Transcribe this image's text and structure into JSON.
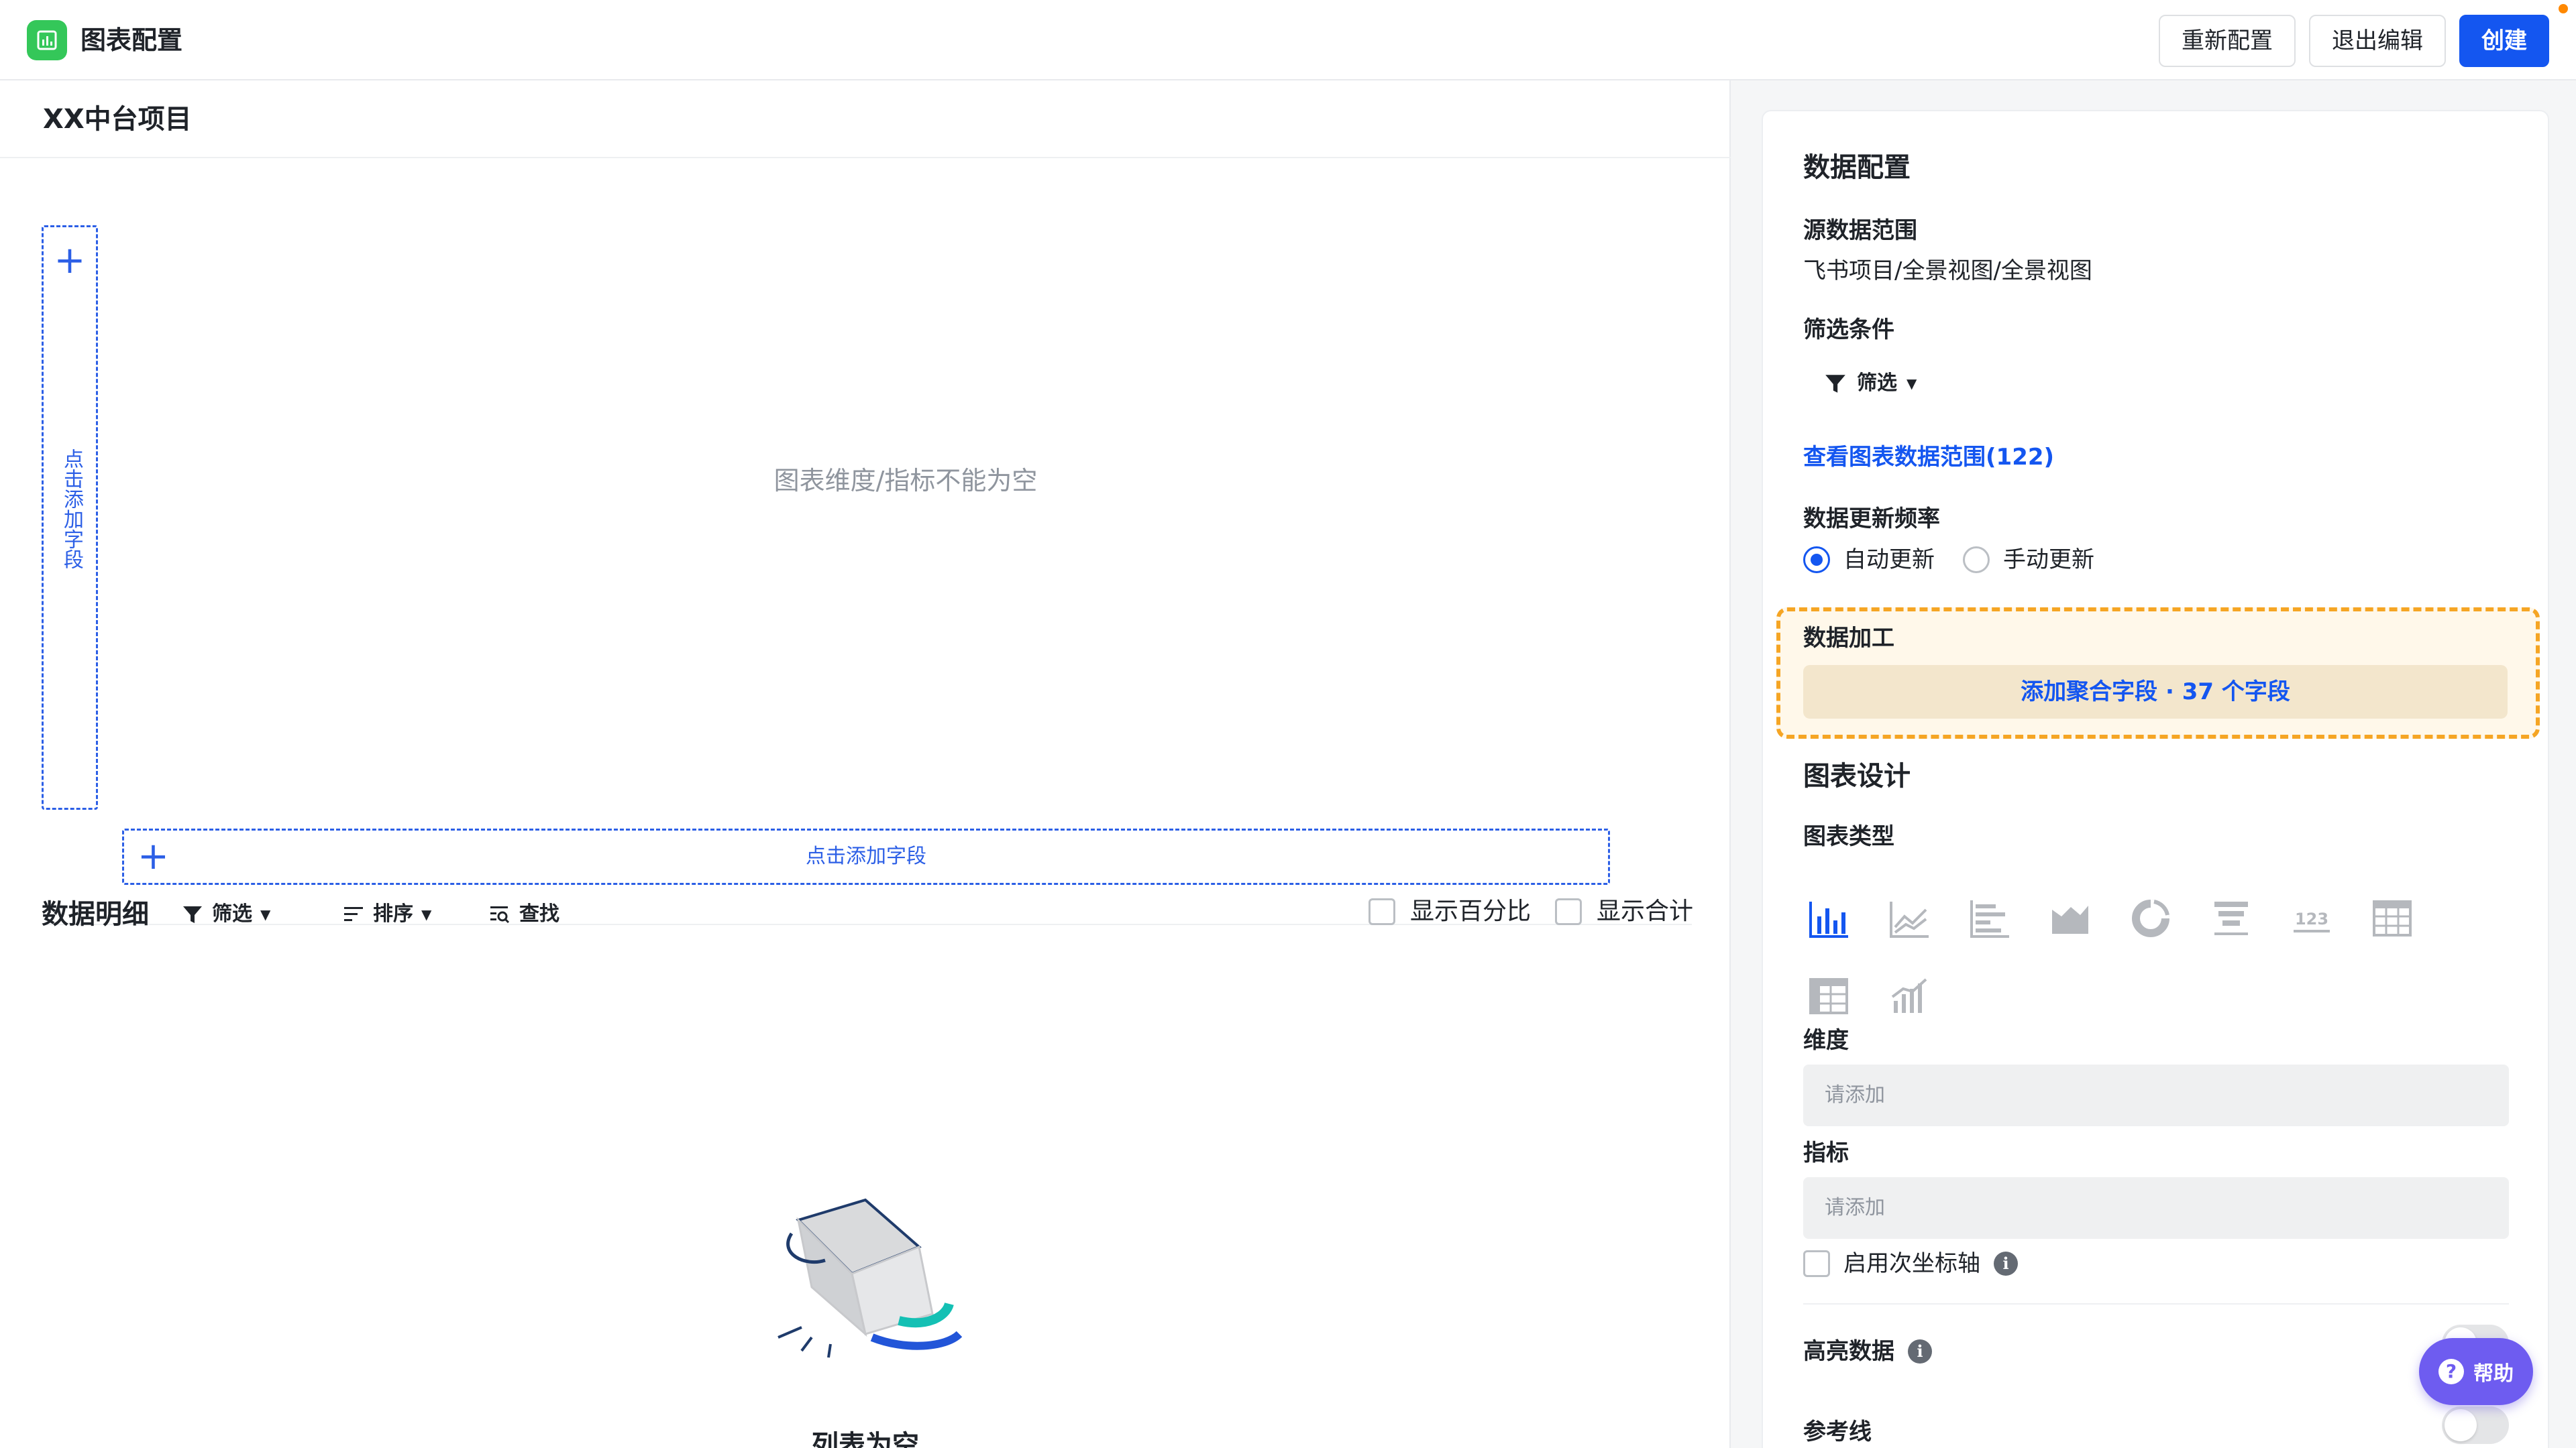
{
  "app": {
    "title": "图表配置",
    "buttons": {
      "reconfigure": "重新配置",
      "exit_edit": "退出编辑",
      "create": "创建"
    },
    "accent_color": "#1456f0",
    "logo_color": "#34c759"
  },
  "left": {
    "project_title": "XX中台项目",
    "vertical_drop_label": "点击添加字段",
    "horizontal_drop_label": "点击添加字段",
    "empty_chart_message": "图表维度/指标不能为空",
    "detail": {
      "title": "数据明细",
      "filter": "筛选",
      "sort": "排序",
      "find": "查找",
      "show_percent": "显示百分比",
      "show_total": "显示合计",
      "empty_list": "列表为空"
    }
  },
  "right": {
    "data_config_title": "数据配置",
    "source_label": "源数据范围",
    "source_value": "飞书项目/全景视图/全景视图",
    "filter_label": "筛选条件",
    "filter_button": "筛选",
    "view_range_link": "查看图表数据范围(122)",
    "update_freq_label": "数据更新频率",
    "update_auto": "自动更新",
    "update_manual": "手动更新",
    "update_selected": "自动更新",
    "processing": {
      "title": "数据加工",
      "add_aggregate": "添加聚合字段 · 37 个字段",
      "highlight_color": "#f5a524"
    },
    "chart_design_title": "图表设计",
    "chart_type_label": "图表类型",
    "chart_types": [
      "bar-chart-icon",
      "line-chart-icon",
      "horizontal-bar-icon",
      "area-chart-icon",
      "pie-chart-icon",
      "funnel-chart-icon",
      "number-card-icon",
      "table-icon",
      "pivot-table-icon",
      "combo-chart-icon"
    ],
    "selected_chart_type": "bar-chart-icon",
    "dimension_label": "维度",
    "dimension_placeholder": "请添加",
    "metric_label": "指标",
    "metric_placeholder": "请添加",
    "secondary_axis": "启用次坐标轴",
    "highlight_data": "高亮数据",
    "reference_line": "参考线"
  },
  "help": {
    "label": "帮助"
  }
}
